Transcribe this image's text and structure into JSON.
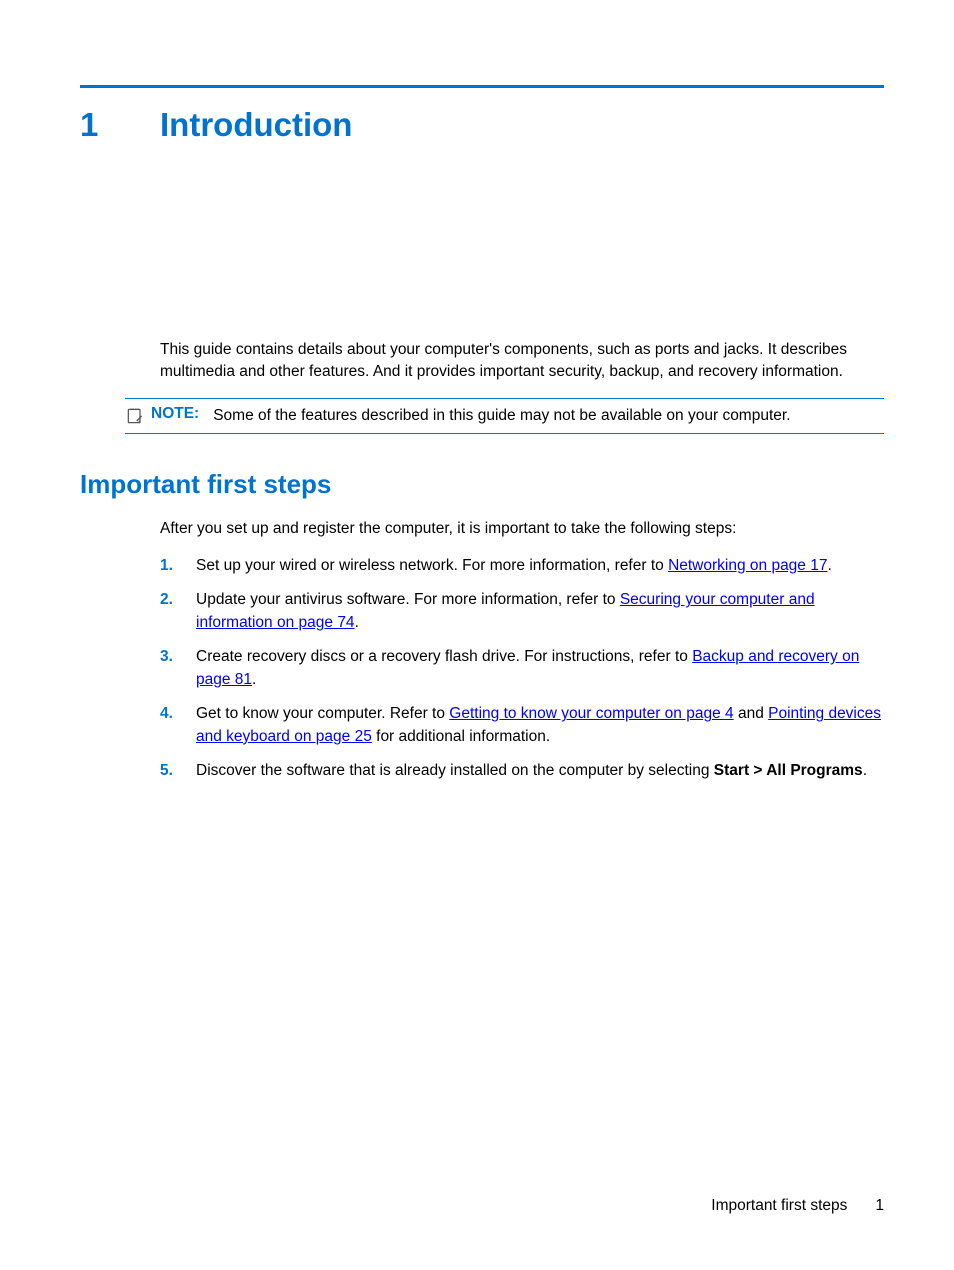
{
  "chapter": {
    "number": "1",
    "title": "Introduction"
  },
  "intro_paragraph": "This guide contains details about your computer's components, such as ports and jacks. It describes multimedia and other features. And it provides important security, backup, and recovery information.",
  "note": {
    "label": "NOTE:",
    "text": "Some of the features described in this guide may not be available on your computer."
  },
  "section": {
    "heading": "Important first steps",
    "intro": "After you set up and register the computer, it is important to take the following steps:",
    "items": [
      {
        "num": "1.",
        "pre": "Set up your wired or wireless network. For more information, refer to ",
        "link": "Networking on page 17",
        "post": "."
      },
      {
        "num": "2.",
        "pre": "Update your antivirus software. For more information, refer to ",
        "link": "Securing your computer and information on page 74",
        "post": "."
      },
      {
        "num": "3.",
        "pre": "Create recovery discs or a recovery flash drive. For instructions, refer to ",
        "link": "Backup and recovery on page 81",
        "post": "."
      },
      {
        "num": "4.",
        "pre": "Get to know your computer. Refer to ",
        "link1": "Getting to know your computer on page 4",
        "mid": " and ",
        "link2": "Pointing devices and keyboard on page 25",
        "post": " for additional information."
      },
      {
        "num": "5.",
        "pre": "Discover the software that is already installed on the computer by selecting ",
        "bold": "Start > All Programs",
        "post": "."
      }
    ]
  },
  "footer": {
    "text": "Important first steps",
    "page": "1"
  }
}
